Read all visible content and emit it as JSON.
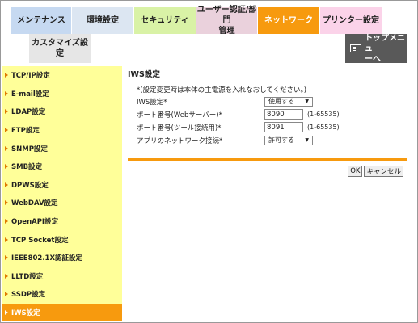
{
  "tabs": {
    "maintenance": "メンテナンス",
    "environment": "環境設定",
    "security": "セキュリティ",
    "user_auth_line1": "ユーザー認証/部門",
    "user_auth_line2": "管理",
    "network": "ネットワーク",
    "printer": "プリンター設定",
    "customize": "カスタマイズ設定",
    "top_menu_line1": "トップメニュ",
    "top_menu_line2": "ーへ"
  },
  "sidebar": {
    "items": [
      {
        "label": "TCP/IP設定"
      },
      {
        "label": "E-mail設定"
      },
      {
        "label": "LDAP設定"
      },
      {
        "label": "FTP設定"
      },
      {
        "label": "SNMP設定"
      },
      {
        "label": "SMB設定"
      },
      {
        "label": "DPWS設定"
      },
      {
        "label": "WebDAV設定"
      },
      {
        "label": "OpenAPI設定"
      },
      {
        "label": "TCP Socket設定"
      },
      {
        "label": "IEEE802.1X認証設定"
      },
      {
        "label": "LLTD設定"
      },
      {
        "label": "SSDP設定"
      },
      {
        "label": "IWS設定"
      }
    ]
  },
  "main": {
    "title": "IWS設定",
    "note": "*(設定変更時は本体の主電源を入れなおしてください。)",
    "iws_label": "IWS設定*",
    "iws_value": "使用する",
    "web_port_label": "ポート番号(Webサーバー)*",
    "web_port_value": "8090",
    "web_port_range": "(1-65535)",
    "tool_port_label": "ポート番号(ツール接続用)*",
    "tool_port_value": "8091",
    "tool_port_range": "(1-65535)",
    "net_conn_label": "アプリのネットワーク接続*",
    "net_conn_value": "許可する"
  },
  "buttons": {
    "ok": "OK",
    "cancel": "キャンセル"
  },
  "colors": {
    "accent": "#f79a0e",
    "sidebar_bg": "#ffff99"
  }
}
